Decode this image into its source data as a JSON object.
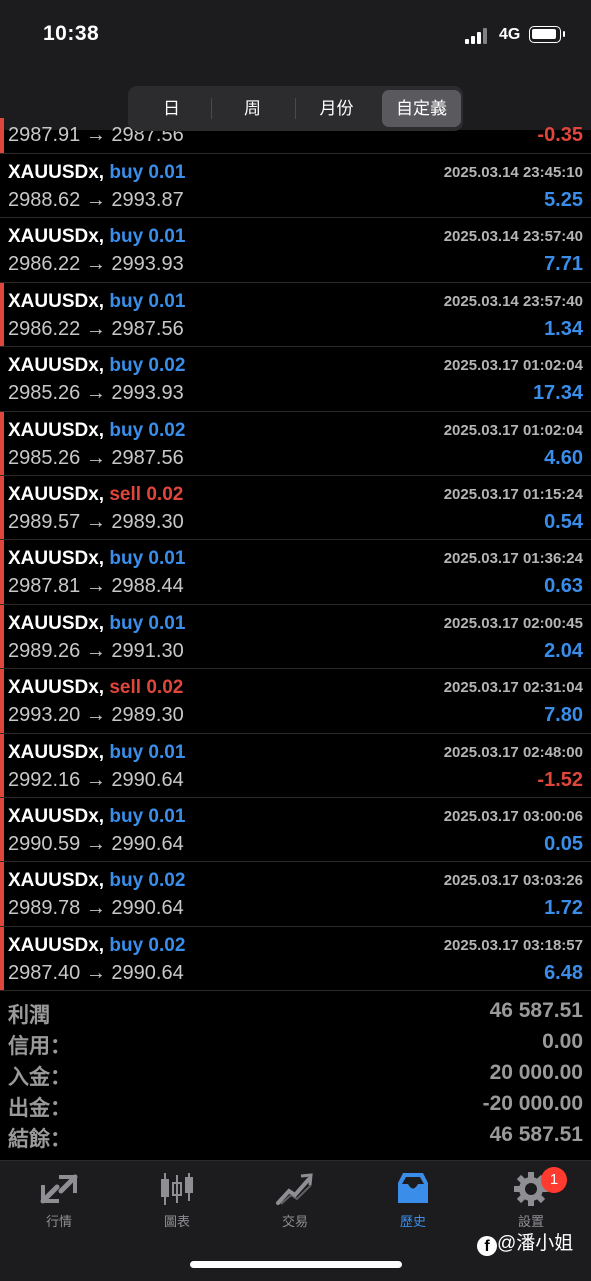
{
  "status_bar": {
    "time": "10:38",
    "network": "4G"
  },
  "period_tabs": [
    "日",
    "周",
    "月份",
    "自定義"
  ],
  "active_period_index": 3,
  "first_row": {
    "prices": "2987.91 → 2987.56",
    "profit": "-0.35"
  },
  "trades": [
    {
      "symbol": "XAUUSDx,",
      "side": "buy",
      "volume": "0.01",
      "time": "2025.03.14 23:45:10",
      "prices": "2988.62 → 2993.87",
      "profit": "5.25",
      "marked": false
    },
    {
      "symbol": "XAUUSDx,",
      "side": "buy",
      "volume": "0.01",
      "time": "2025.03.14 23:57:40",
      "prices": "2986.22 → 2993.93",
      "profit": "7.71",
      "marked": false
    },
    {
      "symbol": "XAUUSDx,",
      "side": "buy",
      "volume": "0.01",
      "time": "2025.03.14 23:57:40",
      "prices": "2986.22 → 2987.56",
      "profit": "1.34",
      "marked": true
    },
    {
      "symbol": "XAUUSDx,",
      "side": "buy",
      "volume": "0.02",
      "time": "2025.03.17 01:02:04",
      "prices": "2985.26 → 2993.93",
      "profit": "17.34",
      "marked": false
    },
    {
      "symbol": "XAUUSDx,",
      "side": "buy",
      "volume": "0.02",
      "time": "2025.03.17 01:02:04",
      "prices": "2985.26 → 2987.56",
      "profit": "4.60",
      "marked": true
    },
    {
      "symbol": "XAUUSDx,",
      "side": "sell",
      "volume": "0.02",
      "time": "2025.03.17 01:15:24",
      "prices": "2989.57 → 2989.30",
      "profit": "0.54",
      "marked": true
    },
    {
      "symbol": "XAUUSDx,",
      "side": "buy",
      "volume": "0.01",
      "time": "2025.03.17 01:36:24",
      "prices": "2987.81 → 2988.44",
      "profit": "0.63",
      "marked": true
    },
    {
      "symbol": "XAUUSDx,",
      "side": "buy",
      "volume": "0.01",
      "time": "2025.03.17 02:00:45",
      "prices": "2989.26 → 2991.30",
      "profit": "2.04",
      "marked": true
    },
    {
      "symbol": "XAUUSDx,",
      "side": "sell",
      "volume": "0.02",
      "time": "2025.03.17 02:31:04",
      "prices": "2993.20 → 2989.30",
      "profit": "7.80",
      "marked": true
    },
    {
      "symbol": "XAUUSDx,",
      "side": "buy",
      "volume": "0.01",
      "time": "2025.03.17 02:48:00",
      "prices": "2992.16 → 2990.64",
      "profit": "-1.52",
      "marked": true
    },
    {
      "symbol": "XAUUSDx,",
      "side": "buy",
      "volume": "0.01",
      "time": "2025.03.17 03:00:06",
      "prices": "2990.59 → 2990.64",
      "profit": "0.05",
      "marked": true
    },
    {
      "symbol": "XAUUSDx,",
      "side": "buy",
      "volume": "0.02",
      "time": "2025.03.17 03:03:26",
      "prices": "2989.78 → 2990.64",
      "profit": "1.72",
      "marked": true
    },
    {
      "symbol": "XAUUSDx,",
      "side": "buy",
      "volume": "0.02",
      "time": "2025.03.17 03:18:57",
      "prices": "2987.40 → 2990.64",
      "profit": "6.48",
      "marked": true
    }
  ],
  "summary": [
    {
      "label": "利潤",
      "value": "46 587.51"
    },
    {
      "label": "信用：",
      "value": "0.00"
    },
    {
      "label": "入金：",
      "value": "20 000.00"
    },
    {
      "label": "出金：",
      "value": "-20 000.00"
    },
    {
      "label": "結餘：",
      "value": "46 587.51"
    }
  ],
  "tabbar": [
    {
      "label": "行情",
      "icon": "quotes-icon"
    },
    {
      "label": "圖表",
      "icon": "chart-icon"
    },
    {
      "label": "交易",
      "icon": "trade-icon"
    },
    {
      "label": "歷史",
      "icon": "history-icon"
    },
    {
      "label": "設置",
      "icon": "settings-icon"
    }
  ],
  "active_tab_index": 3,
  "settings_badge": "1",
  "watermark": "@潘小姐",
  "colors": {
    "buy": "#3a8eea",
    "sell": "#e0463c",
    "marker": "#e0463c",
    "active_tab": "#3a8eea"
  }
}
